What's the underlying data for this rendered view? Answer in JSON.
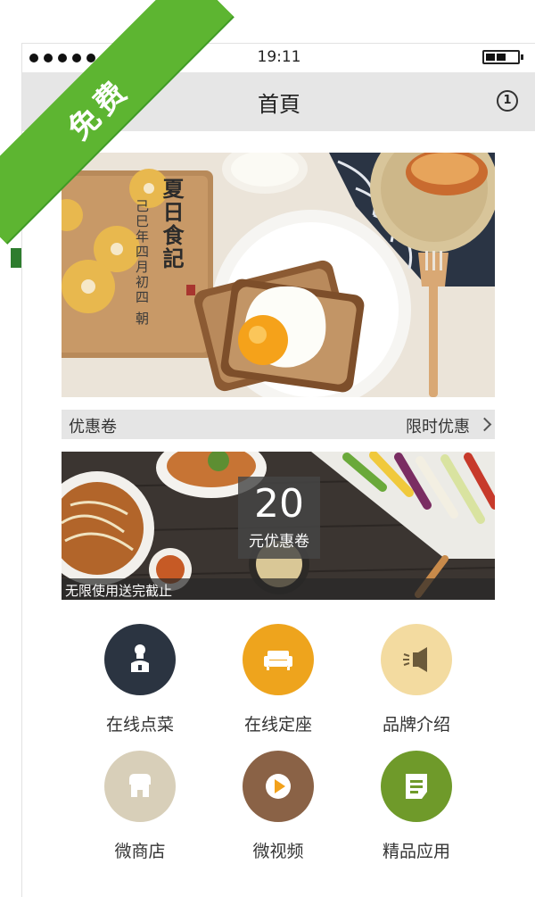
{
  "status": {
    "time": "19:11"
  },
  "nav": {
    "title": "首頁",
    "notify_count": "1"
  },
  "hero": {
    "caption": "夏日食記",
    "subcaption": "己巳年四月初四 朝"
  },
  "coupon": {
    "title": "优惠卷",
    "more": "限时优惠"
  },
  "promo": {
    "amount": "20",
    "unit": "元优惠卷",
    "footer": "无限使用送完截止"
  },
  "grid": [
    {
      "label": "在线点菜",
      "icon": "chef-icon",
      "color": "#2b3441"
    },
    {
      "label": "在线定座",
      "icon": "sofa-icon",
      "color": "#eea41d"
    },
    {
      "label": "品牌介绍",
      "icon": "speaker-icon",
      "color": "#f3dba0"
    },
    {
      "label": "微商店",
      "icon": "shop-icon",
      "color": "#d8cfb9"
    },
    {
      "label": "微视频",
      "icon": "play-icon",
      "color": "#8a6246"
    },
    {
      "label": "精品应用",
      "icon": "app-list-icon",
      "color": "#6f9a2a"
    }
  ],
  "ribbon": {
    "label": "免费"
  }
}
